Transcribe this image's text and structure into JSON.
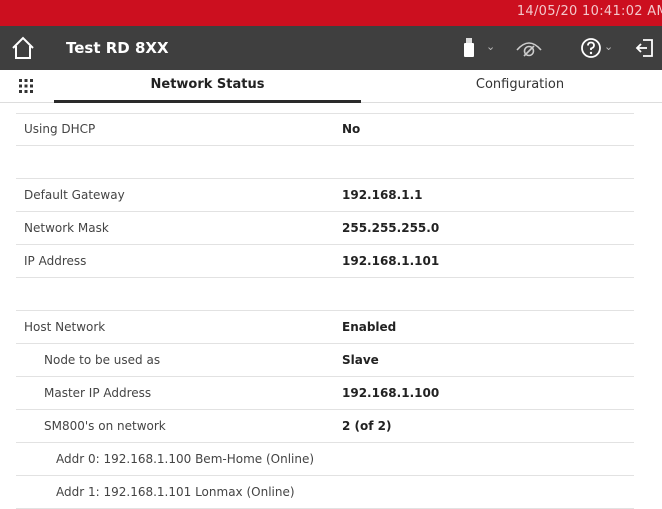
{
  "status": {
    "datetime": "14/05/20 10:41:02 AM"
  },
  "header": {
    "title": "Test RD 8XX",
    "icons": [
      "home-icon",
      "usb-icon",
      "visibility-off-icon",
      "help-icon",
      "logout-icon"
    ]
  },
  "tabs": [
    {
      "label": "Network Status",
      "active": true
    },
    {
      "label": "Configuration",
      "active": false
    }
  ],
  "rows": [
    {
      "label": "Using DHCP",
      "value": "No"
    },
    {
      "label": "",
      "value": ""
    },
    {
      "label": "Default Gateway",
      "value": "192.168.1.1"
    },
    {
      "label": "Network Mask",
      "value": "255.255.255.0"
    },
    {
      "label": "IP Address",
      "value": "192.168.1.101"
    },
    {
      "label": "",
      "value": ""
    },
    {
      "label": "Host Network",
      "value": "Enabled"
    },
    {
      "label": "Node to be used as",
      "value": "Slave"
    },
    {
      "label": "Master IP Address",
      "value": "192.168.1.100"
    },
    {
      "label": "SM800's on network",
      "value": "2 (of 2)"
    },
    {
      "label": "Addr 0: 192.168.1.100 Bem-Home (Online)",
      "value": ""
    },
    {
      "label": "Addr 1: 192.168.1.101 Lonmax (Online)",
      "value": ""
    }
  ],
  "colors": {
    "status_bar": "#cc0f1f",
    "title_bar": "#3f3f3f"
  }
}
